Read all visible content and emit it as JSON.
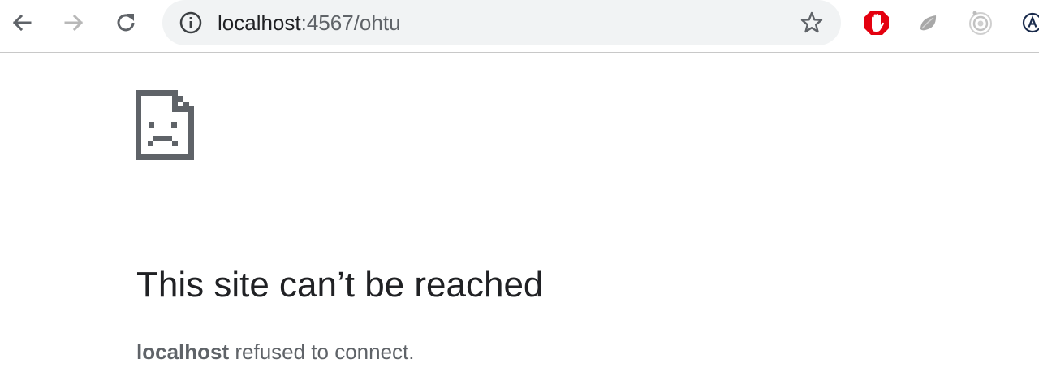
{
  "browser": {
    "url_host": "localhost",
    "url_path": ":4567/ohtu",
    "icons": {
      "back": "back-arrow-icon",
      "forward": "forward-arrow-icon",
      "reload": "reload-icon",
      "info": "info-icon",
      "bookmark": "star-icon"
    },
    "extensions": [
      {
        "name": "adblock-icon",
        "color": "#e4000f"
      },
      {
        "name": "gray-leaf-extension-icon",
        "color": "#9e9e9e"
      },
      {
        "name": "gray-target-extension-icon",
        "color": "#bdbdbd"
      },
      {
        "name": "account-a-icon",
        "color": "#1a2b4c"
      }
    ]
  },
  "error_page": {
    "icon": "sad-document-icon",
    "title": "This site can’t be reached",
    "host": "localhost",
    "message": " refused to connect."
  },
  "colors": {
    "text_primary": "#202124",
    "text_secondary": "#5f6368",
    "omnibox_bg": "#f1f3f4"
  }
}
